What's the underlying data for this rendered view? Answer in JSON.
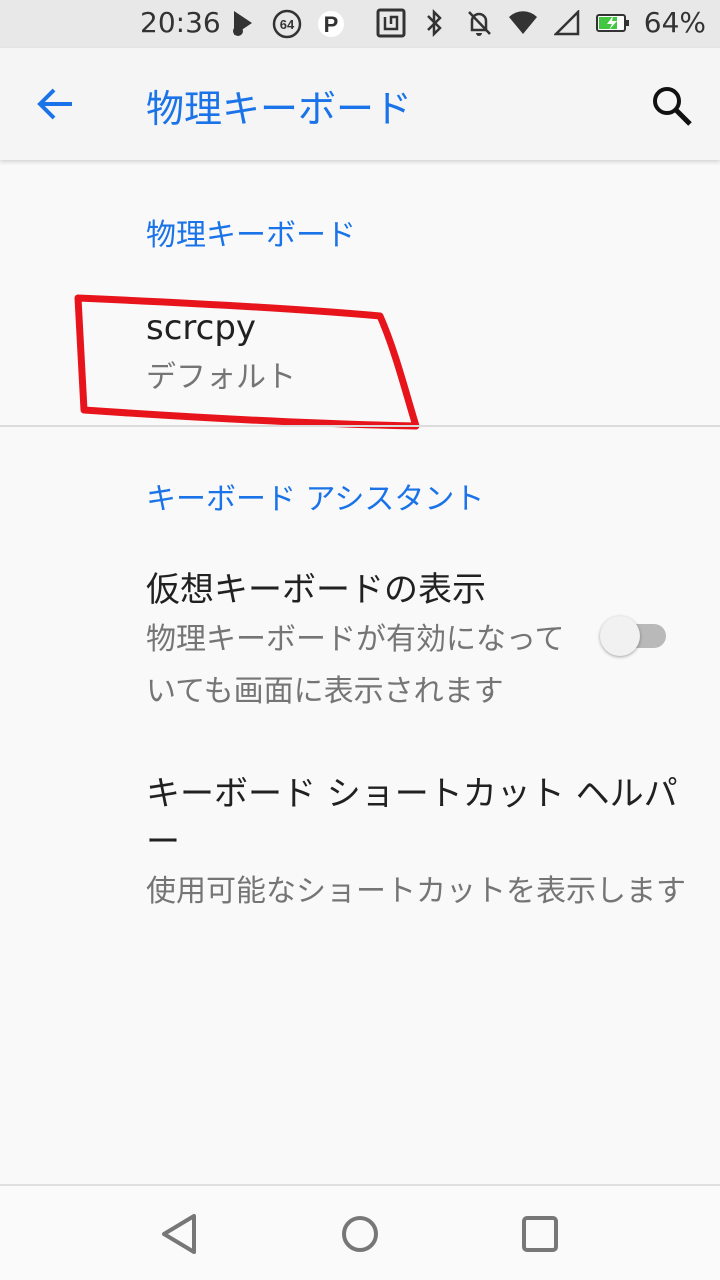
{
  "status_bar": {
    "time": "20:36",
    "battery_percent": "64%",
    "icons_left": [
      "music-note-icon",
      "badge-64-icon",
      "parking-icon"
    ],
    "icons_right": [
      "nfc-icon",
      "bluetooth-icon",
      "notifications-off-icon",
      "wifi-icon",
      "signal-icon",
      "battery-charging-icon"
    ],
    "badge_text": "64",
    "parking_text": "P"
  },
  "app_bar": {
    "title": "物理キーボード"
  },
  "sections": {
    "physical_keyboard": {
      "header": "物理キーボード",
      "item_title": "scrcpy",
      "item_summary": "デフォルト"
    },
    "keyboard_assistant": {
      "header": "キーボード アシスタント",
      "virtual_keyboard": {
        "title": "仮想キーボードの表示",
        "summary": "物理キーボードが有効になっていても画面に表示されます",
        "toggle_on": false
      },
      "shortcut_helper": {
        "title": "キーボード ショートカット ヘルパー",
        "summary": "使用可能なショートカットを表示します"
      }
    }
  },
  "colors": {
    "accent": "#1a73e8",
    "annotation": "#e8141c",
    "background": "#f9f9f9"
  }
}
